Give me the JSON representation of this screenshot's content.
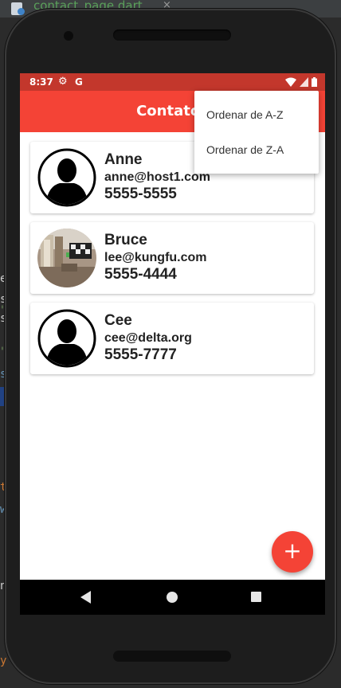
{
  "ide": {
    "tab_label": "contact_page.dart",
    "close_glyph": "×",
    "gutter_glyphs": [
      "e",
      "s",
      "\"",
      "s",
      "\"",
      "s",
      "t",
      "w",
      "n",
      "y"
    ]
  },
  "status_bar": {
    "time": "8:37",
    "gear_glyph": "⚙",
    "g_label": "G",
    "color": "#c3372c"
  },
  "app_bar": {
    "title": "Contatos",
    "color": "#f44336"
  },
  "menu": {
    "items": [
      "Ordenar de A-Z",
      "Ordenar de Z-A"
    ]
  },
  "contacts": [
    {
      "name": "Anne",
      "email": "anne@host1.com",
      "phone": "5555-5555",
      "avatar": "person-silhouette-icon"
    },
    {
      "name": "Bruce",
      "email": "lee@kungfu.com",
      "phone": "5555-4444",
      "avatar": "photo"
    },
    {
      "name": "Cee",
      "email": "cee@delta.org",
      "phone": "5555-7777",
      "avatar": "person-silhouette-icon"
    }
  ],
  "fab": {
    "label": "+",
    "color": "#f44336"
  },
  "nav": {
    "back": "back-icon",
    "home": "home-icon",
    "recent": "recent-apps-icon"
  }
}
